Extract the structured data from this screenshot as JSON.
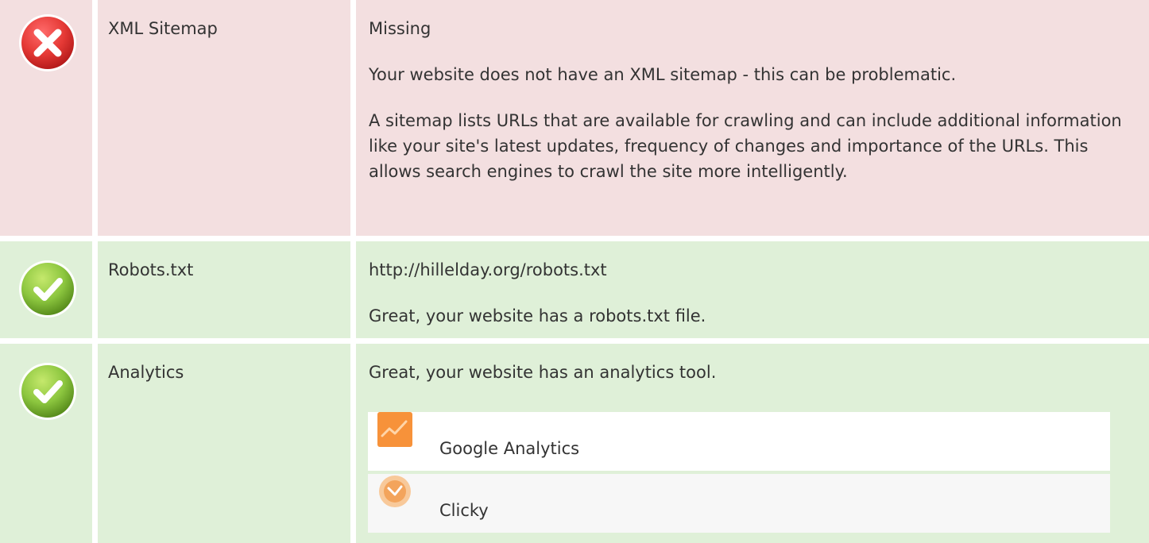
{
  "colors": {
    "fail_bg": "#f3dfe0",
    "pass_bg": "#dff0d8",
    "fail_icon": "#e53935",
    "pass_icon": "#8cc63f"
  },
  "rows": [
    {
      "status": "fail",
      "icon": "error-icon",
      "name": "XML Sitemap",
      "lines": [
        "Missing",
        "Your website does not have an XML sitemap - this can be problematic.",
        "A sitemap lists URLs that are available for crawling and can include additional information like your site's latest updates, frequency of changes and importance of the URLs. This allows search engines to crawl the site more intelligently."
      ]
    },
    {
      "status": "pass",
      "icon": "check-icon",
      "name": "Robots.txt",
      "lines": [
        "http://hillelday.org/robots.txt",
        "Great, your website has a robots.txt file."
      ]
    },
    {
      "status": "pass",
      "icon": "check-icon",
      "name": "Analytics",
      "lines": [
        "Great, your website has an analytics tool."
      ],
      "tools": [
        {
          "name": "Google Analytics",
          "icon": "google-analytics-icon"
        },
        {
          "name": "Clicky",
          "icon": "clicky-icon"
        }
      ]
    }
  ]
}
